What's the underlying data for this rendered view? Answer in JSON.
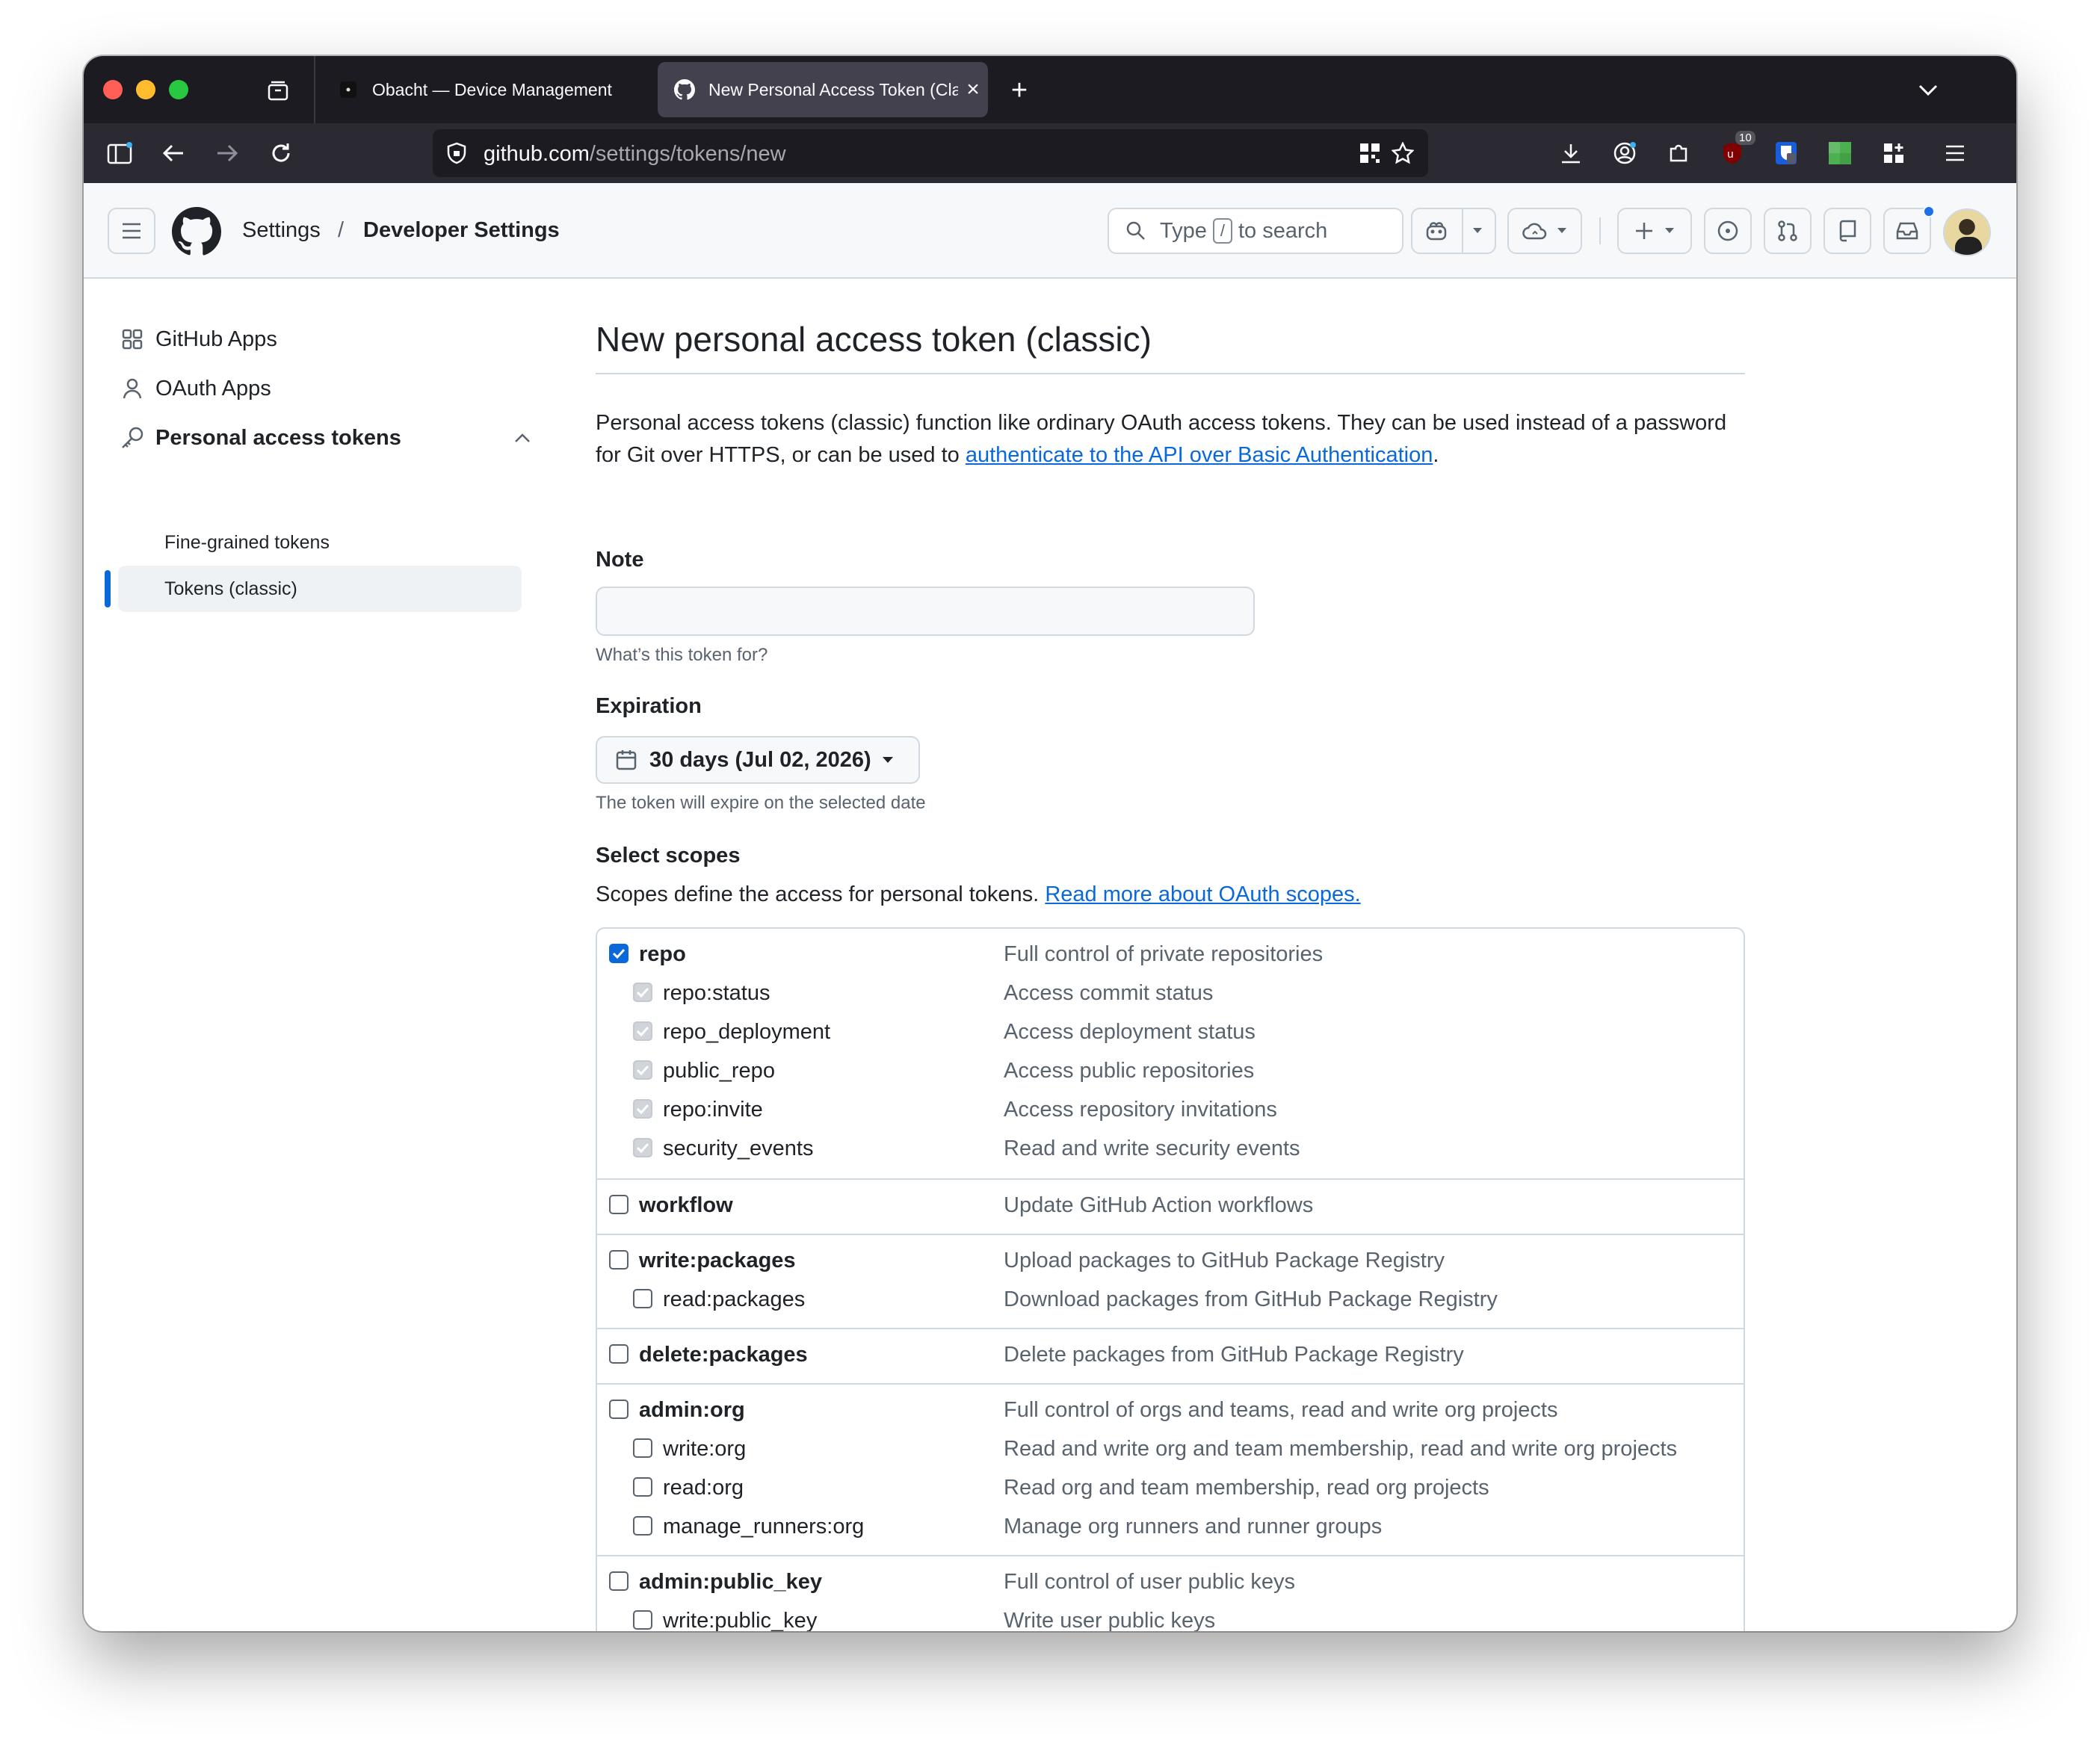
{
  "browser": {
    "tabs": [
      {
        "title": "Obacht — Device Management",
        "active": false
      },
      {
        "title": "New Personal Access Token (Cla",
        "active": true
      }
    ],
    "url_host": "github.com",
    "url_path": "/settings/tokens/new",
    "extension_badge": "10",
    "colors": {
      "tabbar": "#1c1b22",
      "navbar": "#2b2a33",
      "active_tab": "#42414d"
    }
  },
  "header": {
    "breadcrumb_settings": "Settings",
    "breadcrumb_sep": "/",
    "breadcrumb_current": "Developer Settings",
    "search_prefix": "Type",
    "search_key": "/",
    "search_suffix": "to search"
  },
  "sidebar": {
    "items": [
      {
        "label": "GitHub Apps",
        "icon": "apps-grid-icon"
      },
      {
        "label": "OAuth Apps",
        "icon": "person-icon"
      },
      {
        "label": "Personal access tokens",
        "icon": "key-icon"
      }
    ],
    "subitems": [
      {
        "label": "Fine-grained tokens",
        "active": false
      },
      {
        "label": "Tokens (classic)",
        "active": true
      }
    ]
  },
  "page": {
    "title": "New personal access token (classic)",
    "intro_text": "Personal access tokens (classic) function like ordinary OAuth access tokens. They can be used instead of a password for Git over HTTPS, or can be used to ",
    "intro_link": "authenticate to the API over Basic Authentication",
    "intro_end": ".",
    "note_label": "Note",
    "note_value": "",
    "note_hint": "What’s this token for?",
    "expiration_label": "Expiration",
    "expiration_value": "30 days (Jul 02, 2026)",
    "expiration_hint": "The token will expire on the selected date",
    "scopes_label": "Select scopes",
    "scopes_text": "Scopes define the access for personal tokens.",
    "scopes_link": "Read more about OAuth scopes."
  },
  "scope_groups": [
    {
      "name": "repo",
      "desc": "Full control of private repositories",
      "checked": true,
      "children": [
        {
          "name": "repo:status",
          "desc": "Access commit status",
          "checked": true
        },
        {
          "name": "repo_deployment",
          "desc": "Access deployment status",
          "checked": true
        },
        {
          "name": "public_repo",
          "desc": "Access public repositories",
          "checked": true
        },
        {
          "name": "repo:invite",
          "desc": "Access repository invitations",
          "checked": true
        },
        {
          "name": "security_events",
          "desc": "Read and write security events",
          "checked": true
        }
      ]
    },
    {
      "name": "workflow",
      "desc": "Update GitHub Action workflows",
      "checked": false,
      "children": []
    },
    {
      "name": "write:packages",
      "desc": "Upload packages to GitHub Package Registry",
      "checked": false,
      "children": [
        {
          "name": "read:packages",
          "desc": "Download packages from GitHub Package Registry",
          "checked": false
        }
      ]
    },
    {
      "name": "delete:packages",
      "desc": "Delete packages from GitHub Package Registry",
      "checked": false,
      "children": []
    },
    {
      "name": "admin:org",
      "desc": "Full control of orgs and teams, read and write org projects",
      "checked": false,
      "children": [
        {
          "name": "write:org",
          "desc": "Read and write org and team membership, read and write org projects",
          "checked": false
        },
        {
          "name": "read:org",
          "desc": "Read org and team membership, read org projects",
          "checked": false
        },
        {
          "name": "manage_runners:org",
          "desc": "Manage org runners and runner groups",
          "checked": false
        }
      ]
    },
    {
      "name": "admin:public_key",
      "desc": "Full control of user public keys",
      "checked": false,
      "children": [
        {
          "name": "write:public_key",
          "desc": "Write user public keys",
          "checked": false
        }
      ]
    }
  ]
}
